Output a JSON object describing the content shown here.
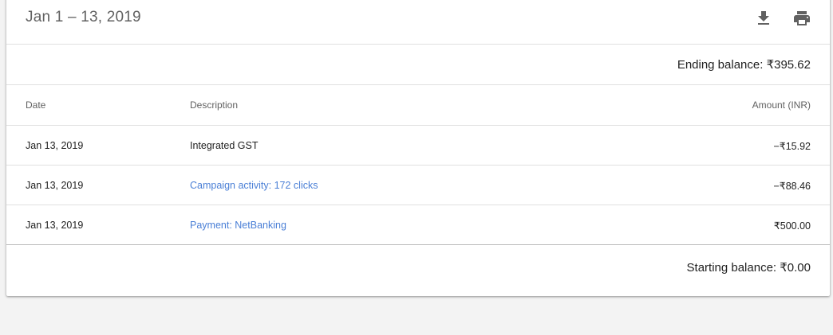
{
  "header": {
    "date_range": "Jan 1 – 13, 2019",
    "download_icon": "download-icon",
    "print_icon": "print-icon"
  },
  "ending_balance": "Ending balance: ₹395.62",
  "table": {
    "columns": [
      "Date",
      "Description",
      "Amount (INR)"
    ],
    "rows": [
      {
        "date": "Jan 13, 2019",
        "description": "Integrated GST",
        "amount": "−₹15.92",
        "is_link": false
      },
      {
        "date": "Jan 13, 2019",
        "description": "Campaign activity: 172 clicks",
        "amount": "−₹88.46",
        "is_link": true
      },
      {
        "date": "Jan 13, 2019",
        "description": "Payment: NetBanking",
        "amount": "₹500.00",
        "is_link": true
      }
    ]
  },
  "starting_balance": "Starting balance: ₹0.00",
  "colors": {
    "link": "#4a7fd6",
    "icon": "#616161",
    "background": "#f3f3f3"
  }
}
